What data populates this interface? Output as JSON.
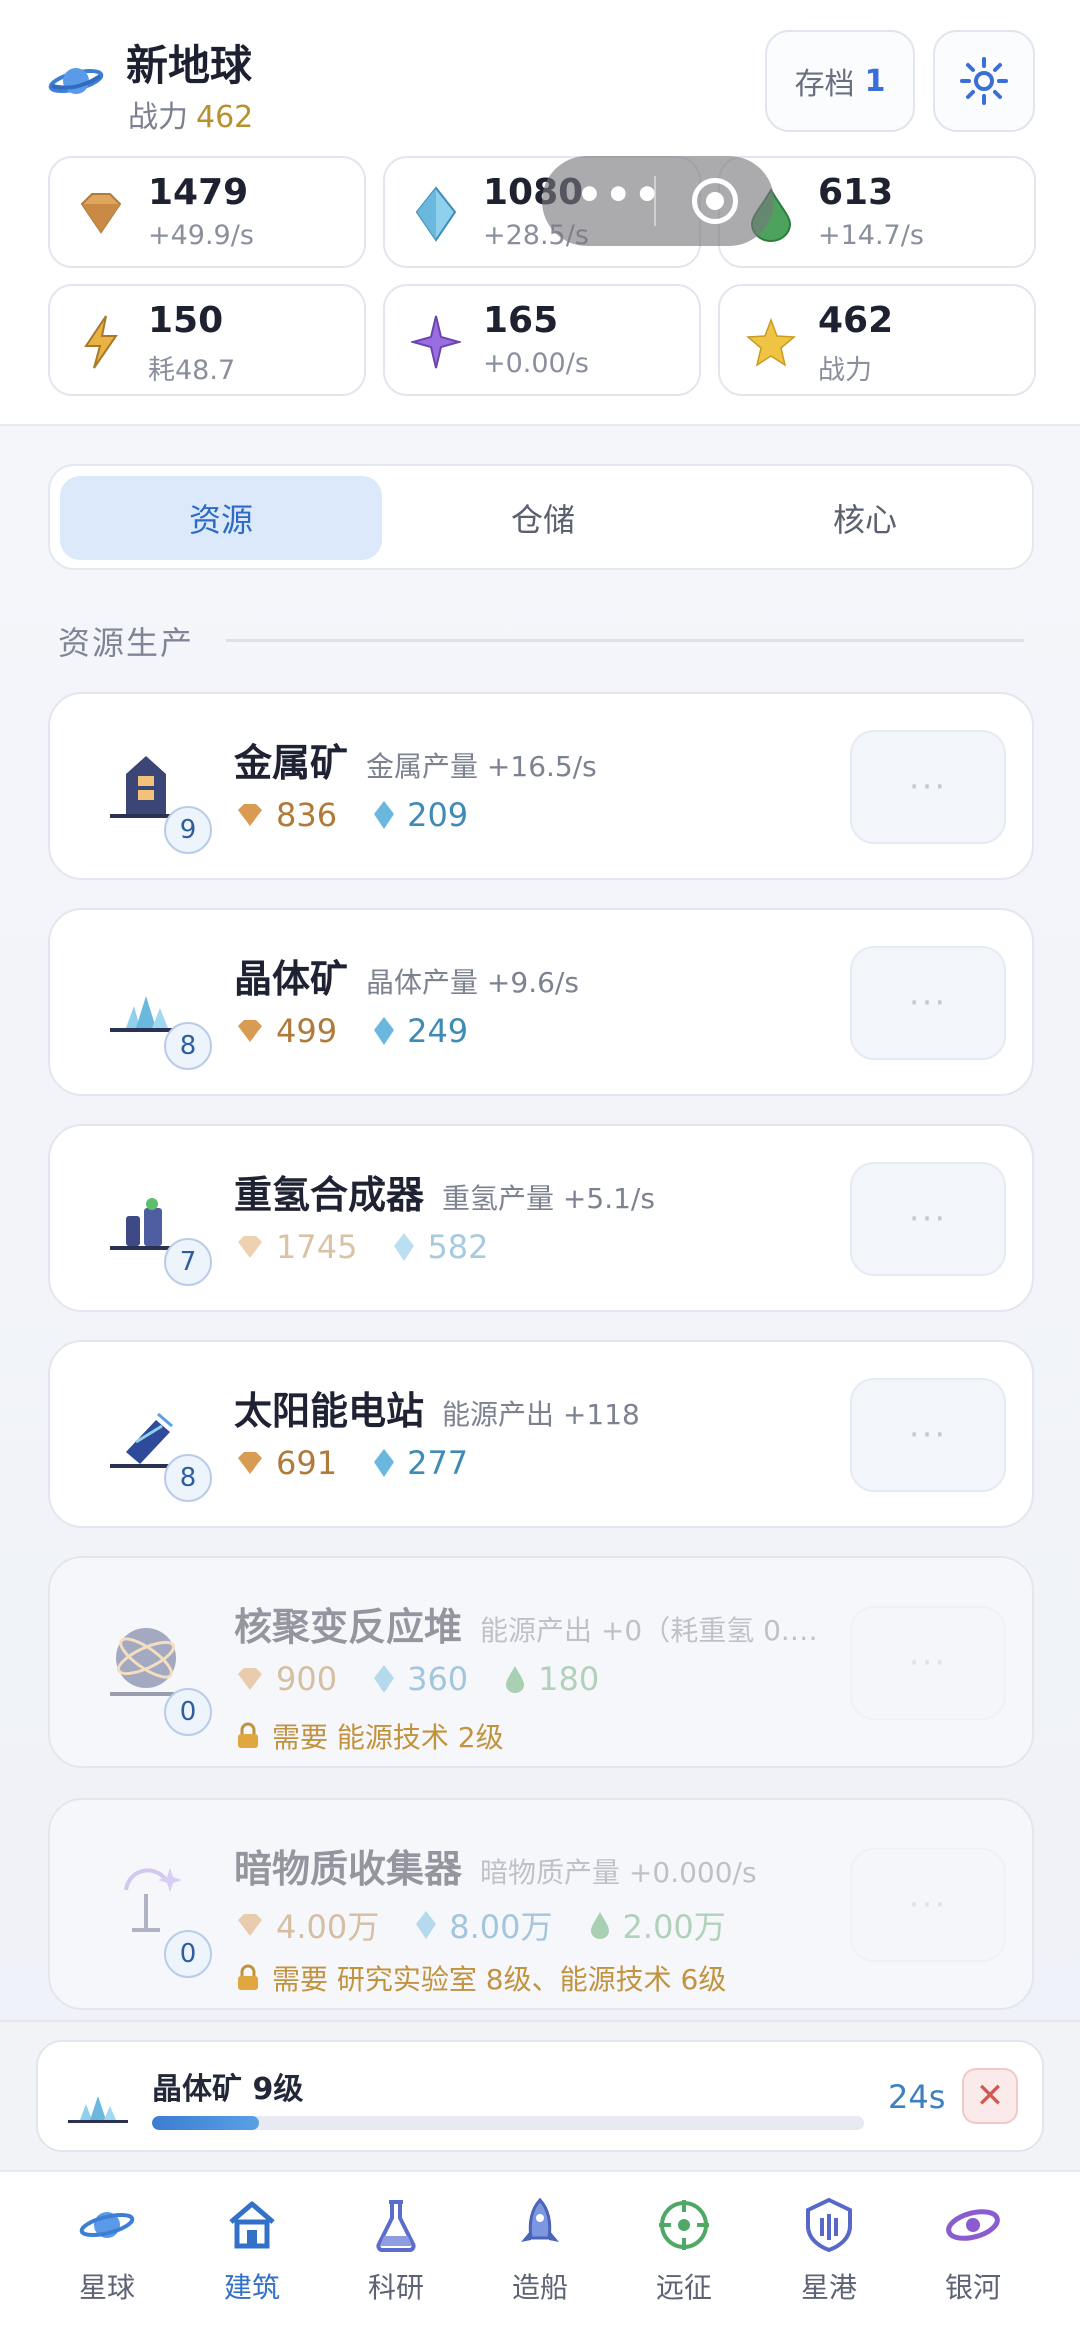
{
  "header": {
    "title": "新地球",
    "power_label": "战力",
    "power_value": "462",
    "save_label": "存档",
    "save_slot": "1"
  },
  "resources": [
    {
      "icon": "metal-icon",
      "value": "1479",
      "sub": "+49.9/s"
    },
    {
      "icon": "crystal-icon",
      "value": "1080",
      "sub": "+28.5/s"
    },
    {
      "icon": "deuterium-icon",
      "value": "613",
      "sub": "+14.7/s"
    },
    {
      "icon": "energy-icon",
      "value": "150",
      "sub": "耗48.7"
    },
    {
      "icon": "dark-matter-icon",
      "value": "165",
      "sub": "+0.00/s"
    },
    {
      "icon": "star-icon",
      "value": "462",
      "sub": "战力"
    }
  ],
  "capsule": {
    "more": "•••"
  },
  "tabs": [
    {
      "label": "资源",
      "active": true
    },
    {
      "label": "仓储",
      "active": false
    },
    {
      "label": "核心",
      "active": false
    }
  ],
  "section": {
    "title": "资源生产"
  },
  "buildings": [
    {
      "name": "金属矿",
      "desc": "金属产量 +16.5/s",
      "level": "9",
      "cost_metal": "836",
      "cost_crystal": "209",
      "action": "···"
    },
    {
      "name": "晶体矿",
      "desc": "晶体产量 +9.6/s",
      "level": "8",
      "cost_metal": "499",
      "cost_crystal": "249",
      "action": "···"
    },
    {
      "name": "重氢合成器",
      "desc": "重氢产量 +5.1/s",
      "level": "7",
      "cost_metal": "1745",
      "cost_crystal": "582",
      "action": "···"
    },
    {
      "name": "太阳能电站",
      "desc": "能源产出 +118",
      "level": "8",
      "cost_metal": "691",
      "cost_crystal": "277",
      "action": "···"
    },
    {
      "name": "核聚变反应堆",
      "desc": "能源产出 +0（耗重氢 0.…",
      "level": "0",
      "cost_metal": "900",
      "cost_crystal": "360",
      "cost_deut": "180",
      "requirement": "需要 能源技术 2级",
      "action": "···"
    },
    {
      "name": "暗物质收集器",
      "desc": "暗物质产量 +0.000/s",
      "level": "0",
      "cost_metal": "4.00万",
      "cost_crystal": "8.00万",
      "cost_deut": "2.00万",
      "requirement": "需要 研究实验室 8级、能源技术 6级",
      "action": "···"
    }
  ],
  "queue": {
    "name": "晶体矿 9级",
    "time": "24s",
    "progress": 0.15,
    "cancel": "✕"
  },
  "nav": [
    {
      "label": "星球",
      "icon": "planet-icon",
      "active": false
    },
    {
      "label": "建筑",
      "icon": "building-icon",
      "active": true
    },
    {
      "label": "科研",
      "icon": "flask-icon",
      "active": false
    },
    {
      "label": "造船",
      "icon": "rocket-icon",
      "active": false
    },
    {
      "label": "远征",
      "icon": "crosshair-icon",
      "active": false
    },
    {
      "label": "星港",
      "icon": "shield-icon",
      "active": false
    },
    {
      "label": "银河",
      "icon": "galaxy-icon",
      "active": false
    }
  ],
  "colors": {
    "accent": "#3370c8",
    "gold": "#b07a3a",
    "crystal": "#3f8bb8",
    "deuterium": "#5fa56f",
    "lock": "#c2933f"
  }
}
